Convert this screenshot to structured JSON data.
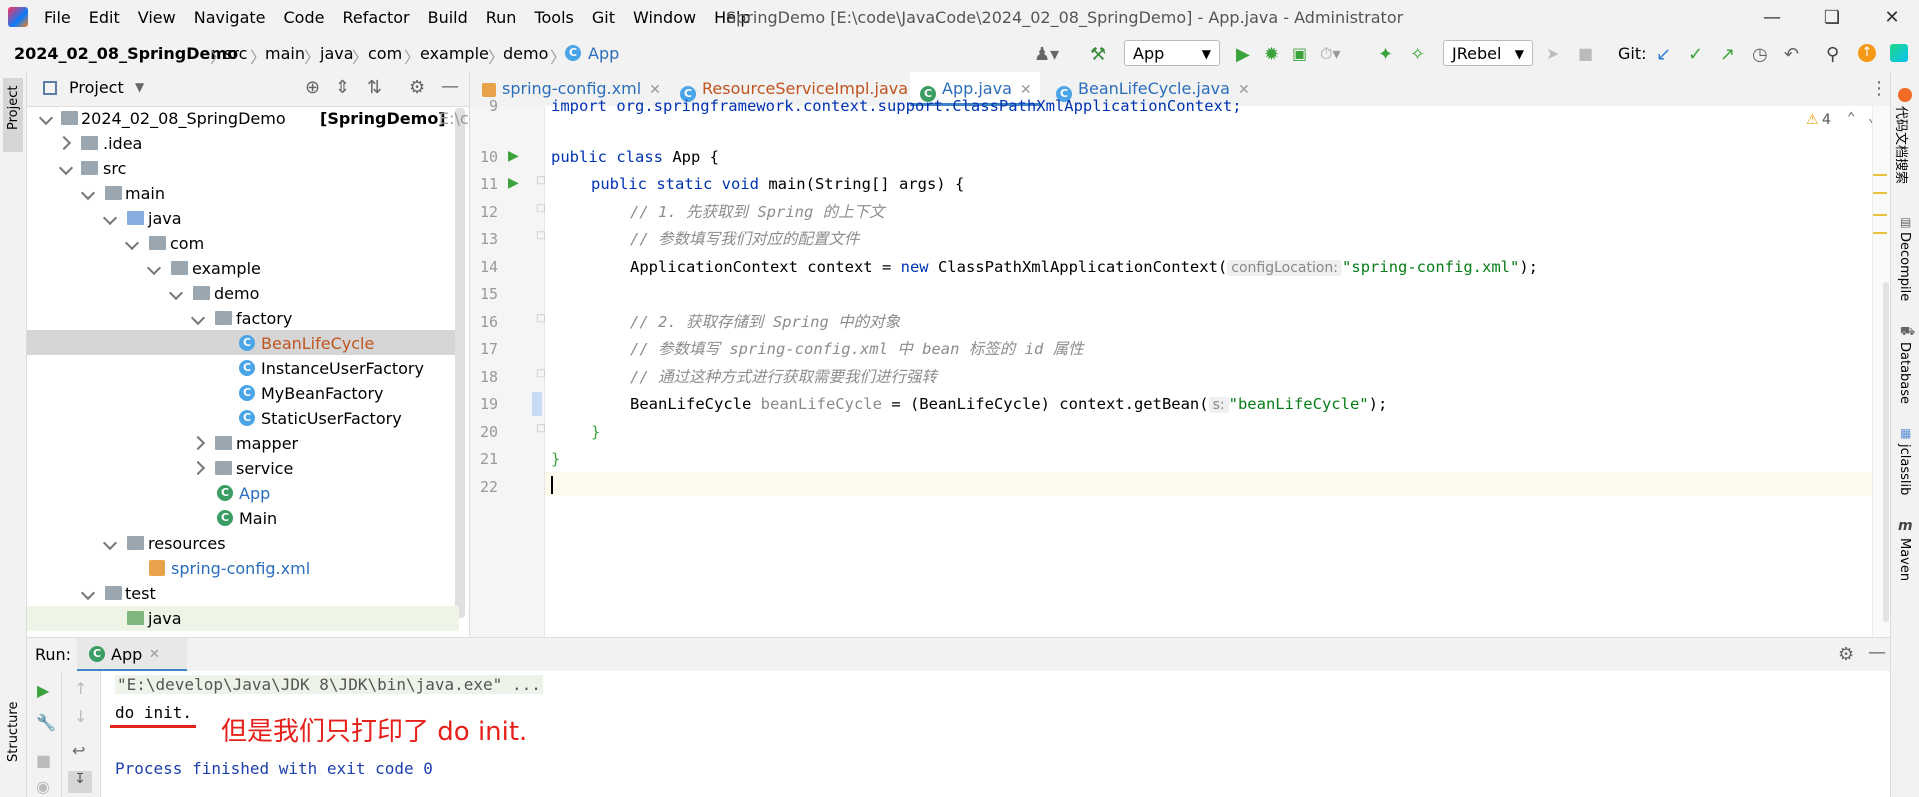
{
  "menu": [
    "File",
    "Edit",
    "View",
    "Navigate",
    "Code",
    "Refactor",
    "Build",
    "Run",
    "Tools",
    "Git",
    "Window",
    "Help"
  ],
  "window_title": "SpringDemo [E:\\code\\JavaCode\\2024_02_08_SpringDemo] - App.java - Administrator",
  "breadcrumb": [
    "2024_02_08_SpringDemo",
    "src",
    "main",
    "java",
    "com",
    "example",
    "demo",
    "App"
  ],
  "toolbar": {
    "run_config": "App",
    "jrebel": "JRebel",
    "git_label": "Git:"
  },
  "project_panel": {
    "title": "Project",
    "tree": [
      {
        "label": "2024_02_08_SpringDemo",
        "suffix": "[SpringDemo]",
        "path": "E:\\code\\Jav"
      },
      {
        "label": ".idea"
      },
      {
        "label": "src"
      },
      {
        "label": "main"
      },
      {
        "label": "java"
      },
      {
        "label": "com"
      },
      {
        "label": "example"
      },
      {
        "label": "demo"
      },
      {
        "label": "factory"
      },
      {
        "label": "BeanLifeCycle"
      },
      {
        "label": "InstanceUserFactory"
      },
      {
        "label": "MyBeanFactory"
      },
      {
        "label": "StaticUserFactory"
      },
      {
        "label": "mapper"
      },
      {
        "label": "service"
      },
      {
        "label": "App"
      },
      {
        "label": "Main"
      },
      {
        "label": "resources"
      },
      {
        "label": "spring-config.xml"
      },
      {
        "label": "test"
      },
      {
        "label": "java"
      }
    ]
  },
  "tabs": [
    {
      "label": "spring-config.xml"
    },
    {
      "label": "ResourceServiceImpl.java"
    },
    {
      "label": "App.java"
    },
    {
      "label": "BeanLifeCycle.java"
    }
  ],
  "editor": {
    "warnings": "4",
    "line_numbers": [
      "9",
      "10",
      "11",
      "12",
      "13",
      "14",
      "15",
      "16",
      "17",
      "18",
      "19",
      "20",
      "21",
      "22"
    ],
    "lines": {
      "l9": "import org.springframework.context.support.ClassPathXmlApplicationContext;",
      "l10_kw": "public class",
      "l10_rest": " App {",
      "l11_kw": "public static void",
      "l11_rest": " main(String[] args) {",
      "l12": "// 1. 先获取到 Spring 的上下文",
      "l13": "// 参数填写我们对应的配置文件",
      "l14_a": "ApplicationContext context = ",
      "l14_kw": "new",
      "l14_b": " ClassPathXmlApplicationContext(",
      "l14_hint": "configLocation:",
      "l14_str": "\"spring-config.xml\"",
      "l14_end": ");",
      "l16": "// 2. 获取存储到 Spring 中的对象",
      "l17": "// 参数填写 spring-config.xml 中 bean 标签的 id 属性",
      "l18": "// 通过这种方式进行获取需要我们进行强转",
      "l19_a": "BeanLifeCycle ",
      "l19_var": "beanLifeCycle",
      "l19_b": " = (BeanLifeCycle) context.getBean(",
      "l19_hint": "s:",
      "l19_str": "\"beanLifeCycle\"",
      "l19_end": ");",
      "l20": "}",
      "l21": "}"
    }
  },
  "right_tools": [
    "代码文档搜索",
    "Decompile",
    "Database",
    "jclasslib",
    "Maven"
  ],
  "left_tools": [
    "Project",
    "Structure"
  ],
  "run_panel": {
    "label": "Run:",
    "tab": "App",
    "output": [
      "\"E:\\develop\\Java\\JDK 8\\JDK\\bin\\java.exe\" ...",
      "do init.",
      "Process finished with exit code 0"
    ],
    "annotation": "但是我们只打印了 do init."
  }
}
